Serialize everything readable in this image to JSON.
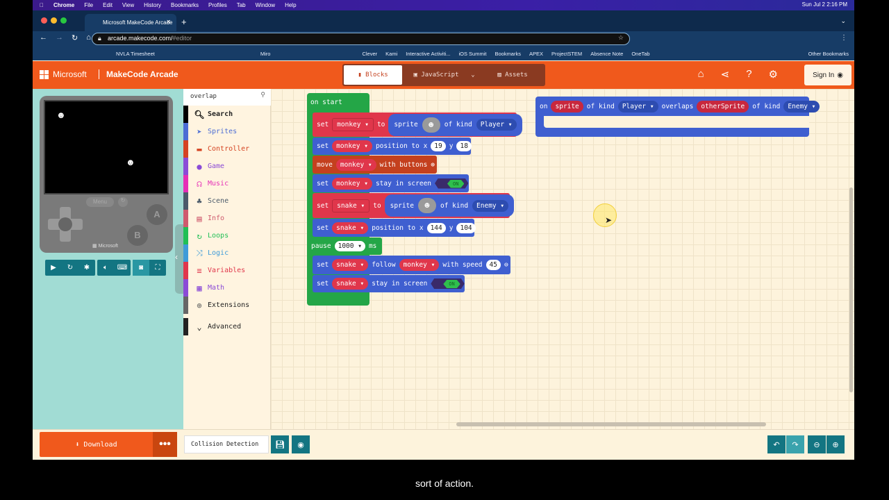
{
  "os_menubar": {
    "apple": "",
    "items": [
      "Chrome",
      "File",
      "Edit",
      "View",
      "History",
      "Bookmarks",
      "Profiles",
      "Tab",
      "Window",
      "Help"
    ],
    "clock": "Sun Jul 2  2:16 PM"
  },
  "browser": {
    "tab_title": "Microsoft MakeCode Arcade",
    "url_host": "arcade.makecode.com/",
    "url_path": "#editor",
    "bookmarks": [
      "NVLA Timesheet",
      "Miro",
      "Clever",
      "Kami",
      "Interactive Activiti...",
      "iOS Summit",
      "Bookmarks",
      "APEX",
      "ProjectSTEM",
      "Absence Note",
      "OneTab",
      "Other Bookmarks"
    ]
  },
  "header": {
    "brand": "Microsoft",
    "title": "MakeCode Arcade",
    "modes": [
      "Blocks",
      "JavaScript",
      "Assets"
    ],
    "active_mode": "Blocks",
    "sign_in": "Sign In"
  },
  "simulator": {
    "menu": "Menu",
    "a": "A",
    "b": "B",
    "brand": "Microsoft"
  },
  "toolbox": {
    "search_value": "overlap",
    "categories": [
      {
        "label": "Search",
        "color": "#000000",
        "icon": "search-icon"
      },
      {
        "label": "Sprites",
        "color": "#4b6cd4",
        "icon": "paper-plane-icon"
      },
      {
        "label": "Controller",
        "color": "#d54322",
        "icon": "gamepad-icon"
      },
      {
        "label": "Game",
        "color": "#8b4bd6",
        "icon": "circle-icon"
      },
      {
        "label": "Music",
        "color": "#e52fb6",
        "icon": "headphones-icon"
      },
      {
        "label": "Scene",
        "color": "#4b5a6a",
        "icon": "tree-icon"
      },
      {
        "label": "Info",
        "color": "#cf5a6e",
        "icon": "id-card-icon"
      },
      {
        "label": "Loops",
        "color": "#20bf55",
        "icon": "loop-icon"
      },
      {
        "label": "Logic",
        "color": "#3e9bd8",
        "icon": "shuffle-icon"
      },
      {
        "label": "Variables",
        "color": "#e0364b",
        "icon": "list-icon"
      },
      {
        "label": "Math",
        "color": "#8b4bd6",
        "icon": "calculator-icon"
      },
      {
        "label": "Extensions",
        "color": "#666666",
        "icon": "plus-circle-icon"
      },
      {
        "label": "Advanced",
        "color": "#222222",
        "icon": "chevron-down-icon"
      }
    ]
  },
  "workspace": {
    "on_start": "on start",
    "blocks": [
      {
        "kind": "var",
        "tokens": [
          "set",
          {
            "dd": "monkey"
          },
          "to",
          {
            "sprite": "sprite",
            "img": "monkey",
            "of": "of kind",
            "kindv": "Player"
          }
        ]
      },
      {
        "kind": "sprite",
        "tokens": [
          "set",
          {
            "dd": "monkey"
          },
          "position to x",
          {
            "num": "19"
          },
          "y",
          {
            "num": "18"
          }
        ]
      },
      {
        "kind": "ctrl",
        "tokens": [
          "move",
          {
            "dd": "monkey"
          },
          "with buttons",
          {
            "icon": "⊕"
          }
        ]
      },
      {
        "kind": "sprite",
        "tokens": [
          "set",
          {
            "dd": "monkey"
          },
          "stay in screen",
          {
            "tog": "ON"
          }
        ]
      },
      {
        "kind": "var",
        "tokens": [
          "set",
          {
            "dd": "snake"
          },
          "to",
          {
            "sprite": "sprite",
            "img": "snake",
            "of": "of kind",
            "kindv": "Enemy"
          }
        ]
      },
      {
        "kind": "sprite",
        "tokens": [
          "set",
          {
            "dd": "snake"
          },
          "position to x",
          {
            "num": "144"
          },
          "y",
          {
            "num": "104"
          }
        ]
      },
      {
        "kind": "loop",
        "tokens": [
          "pause",
          {
            "numdd": "1000"
          },
          "ms"
        ]
      },
      {
        "kind": "sprite",
        "tokens": [
          "set",
          {
            "dd": "snake"
          },
          "follow",
          {
            "dd": "monkey"
          },
          "with speed",
          {
            "num": "45"
          },
          {
            "icon": "⊖"
          }
        ]
      },
      {
        "kind": "sprite",
        "tokens": [
          "set",
          {
            "dd": "snake"
          },
          "stay in screen",
          {
            "tog": "ON"
          }
        ]
      }
    ],
    "overlap_event": [
      "on",
      {
        "vp": "sprite"
      },
      "of kind",
      {
        "kd": "Player"
      },
      "overlaps",
      {
        "vp": "otherSprite"
      },
      "of kind",
      {
        "kd": "Enemy"
      }
    ]
  },
  "colors": {
    "orange": "#f0591c",
    "sprites_blue": "#3f5fd0",
    "variables_red": "#e0364b",
    "loops_green": "#24a647",
    "controller": "#c4401e",
    "teal": "#137582"
  },
  "bottom": {
    "download": "Download",
    "more": "•••",
    "project_name": "Collision Detection"
  },
  "subtitle": "sort of action."
}
